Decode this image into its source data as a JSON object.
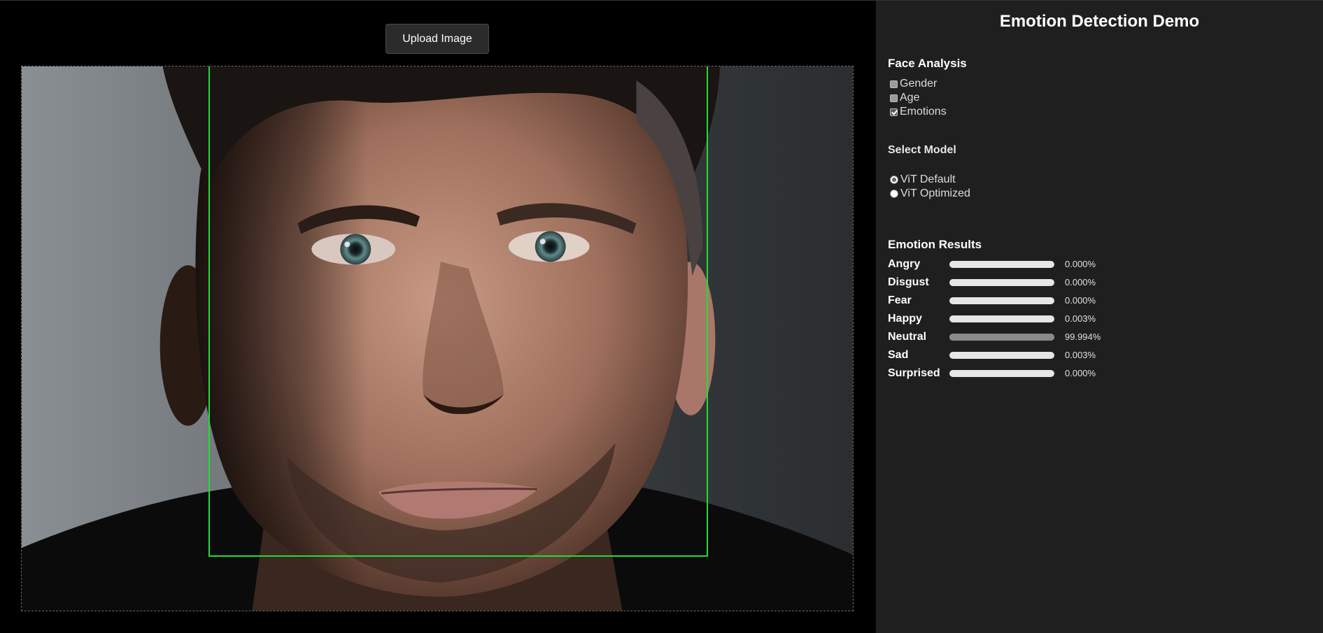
{
  "viewer": {
    "upload_label": "Upload Image"
  },
  "panel": {
    "title": "Emotion Detection Demo",
    "face_analysis": {
      "heading": "Face Analysis",
      "options": [
        {
          "label": "Gender",
          "checked": false
        },
        {
          "label": "Age",
          "checked": false
        },
        {
          "label": "Emotions",
          "checked": true
        }
      ]
    },
    "model": {
      "heading": "Select Model",
      "options": [
        {
          "label": "ViT Default",
          "selected": true
        },
        {
          "label": "ViT Optimized",
          "selected": false
        }
      ]
    },
    "results": {
      "heading": "Emotion Results",
      "items": [
        {
          "label": "Angry",
          "value": "0.000%",
          "fraction": 0.0
        },
        {
          "label": "Disgust",
          "value": "0.000%",
          "fraction": 0.0
        },
        {
          "label": "Fear",
          "value": "0.000%",
          "fraction": 0.0
        },
        {
          "label": "Happy",
          "value": "0.003%",
          "fraction": 3e-05
        },
        {
          "label": "Neutral",
          "value": "99.994%",
          "fraction": 0.99994
        },
        {
          "label": "Sad",
          "value": "0.003%",
          "fraction": 3e-05
        },
        {
          "label": "Surprised",
          "value": "0.000%",
          "fraction": 0.0
        }
      ]
    }
  },
  "colors": {
    "face_box": "#22dd33",
    "panel_bg": "#1f1f1f",
    "viewer_bg": "#000000"
  }
}
